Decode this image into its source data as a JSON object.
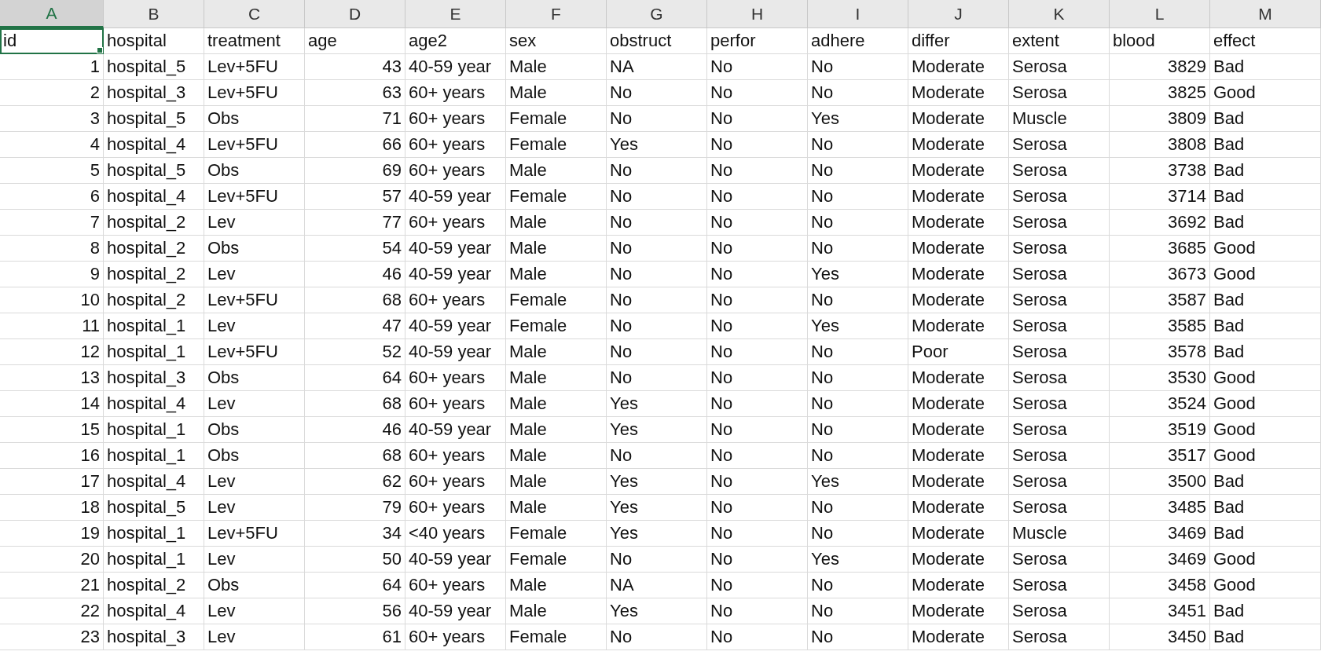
{
  "table": {
    "columns": [
      {
        "letter": "A",
        "selected": true,
        "kind": "number"
      },
      {
        "letter": "B",
        "selected": false,
        "kind": "text"
      },
      {
        "letter": "C",
        "selected": false,
        "kind": "text"
      },
      {
        "letter": "D",
        "selected": false,
        "kind": "number"
      },
      {
        "letter": "E",
        "selected": false,
        "kind": "text"
      },
      {
        "letter": "F",
        "selected": false,
        "kind": "text"
      },
      {
        "letter": "G",
        "selected": false,
        "kind": "text"
      },
      {
        "letter": "H",
        "selected": false,
        "kind": "text"
      },
      {
        "letter": "I",
        "selected": false,
        "kind": "text"
      },
      {
        "letter": "J",
        "selected": false,
        "kind": "text"
      },
      {
        "letter": "K",
        "selected": false,
        "kind": "text"
      },
      {
        "letter": "L",
        "selected": false,
        "kind": "number"
      },
      {
        "letter": "M",
        "selected": false,
        "kind": "text"
      }
    ],
    "header_row": [
      {
        "text": "id",
        "selected": true
      },
      {
        "text": "hospital",
        "selected": false
      },
      {
        "text": "treatment",
        "selected": false
      },
      {
        "text": "age",
        "selected": false
      },
      {
        "text": "age2",
        "selected": false
      },
      {
        "text": "sex",
        "selected": false
      },
      {
        "text": "obstruct",
        "selected": false
      },
      {
        "text": "perfor",
        "selected": false
      },
      {
        "text": "adhere",
        "selected": false
      },
      {
        "text": "differ",
        "selected": false
      },
      {
        "text": "extent",
        "selected": false
      },
      {
        "text": "blood",
        "selected": false
      },
      {
        "text": "effect",
        "selected": false
      }
    ],
    "rows": [
      [
        "1",
        "hospital_5",
        "Lev+5FU",
        "43",
        "40-59 year",
        "Male",
        "NA",
        "No",
        "No",
        "Moderate",
        "Serosa",
        "3829",
        "Bad"
      ],
      [
        "2",
        "hospital_3",
        "Lev+5FU",
        "63",
        "60+ years",
        "Male",
        "No",
        "No",
        "No",
        "Moderate",
        "Serosa",
        "3825",
        "Good"
      ],
      [
        "3",
        "hospital_5",
        "Obs",
        "71",
        "60+ years",
        "Female",
        "No",
        "No",
        "Yes",
        "Moderate",
        "Muscle",
        "3809",
        "Bad"
      ],
      [
        "4",
        "hospital_4",
        "Lev+5FU",
        "66",
        "60+ years",
        "Female",
        "Yes",
        "No",
        "No",
        "Moderate",
        "Serosa",
        "3808",
        "Bad"
      ],
      [
        "5",
        "hospital_5",
        "Obs",
        "69",
        "60+ years",
        "Male",
        "No",
        "No",
        "No",
        "Moderate",
        "Serosa",
        "3738",
        "Bad"
      ],
      [
        "6",
        "hospital_4",
        "Lev+5FU",
        "57",
        "40-59 year",
        "Female",
        "No",
        "No",
        "No",
        "Moderate",
        "Serosa",
        "3714",
        "Bad"
      ],
      [
        "7",
        "hospital_2",
        "Lev",
        "77",
        "60+ years",
        "Male",
        "No",
        "No",
        "No",
        "Moderate",
        "Serosa",
        "3692",
        "Bad"
      ],
      [
        "8",
        "hospital_2",
        "Obs",
        "54",
        "40-59 year",
        "Male",
        "No",
        "No",
        "No",
        "Moderate",
        "Serosa",
        "3685",
        "Good"
      ],
      [
        "9",
        "hospital_2",
        "Lev",
        "46",
        "40-59 year",
        "Male",
        "No",
        "No",
        "Yes",
        "Moderate",
        "Serosa",
        "3673",
        "Good"
      ],
      [
        "10",
        "hospital_2",
        "Lev+5FU",
        "68",
        "60+ years",
        "Female",
        "No",
        "No",
        "No",
        "Moderate",
        "Serosa",
        "3587",
        "Bad"
      ],
      [
        "11",
        "hospital_1",
        "Lev",
        "47",
        "40-59 year",
        "Female",
        "No",
        "No",
        "Yes",
        "Moderate",
        "Serosa",
        "3585",
        "Bad"
      ],
      [
        "12",
        "hospital_1",
        "Lev+5FU",
        "52",
        "40-59 year",
        "Male",
        "No",
        "No",
        "No",
        "Poor",
        "Serosa",
        "3578",
        "Bad"
      ],
      [
        "13",
        "hospital_3",
        "Obs",
        "64",
        "60+ years",
        "Male",
        "No",
        "No",
        "No",
        "Moderate",
        "Serosa",
        "3530",
        "Good"
      ],
      [
        "14",
        "hospital_4",
        "Lev",
        "68",
        "60+ years",
        "Male",
        "Yes",
        "No",
        "No",
        "Moderate",
        "Serosa",
        "3524",
        "Good"
      ],
      [
        "15",
        "hospital_1",
        "Obs",
        "46",
        "40-59 year",
        "Male",
        "Yes",
        "No",
        "No",
        "Moderate",
        "Serosa",
        "3519",
        "Good"
      ],
      [
        "16",
        "hospital_1",
        "Obs",
        "68",
        "60+ years",
        "Male",
        "No",
        "No",
        "No",
        "Moderate",
        "Serosa",
        "3517",
        "Good"
      ],
      [
        "17",
        "hospital_4",
        "Lev",
        "62",
        "60+ years",
        "Male",
        "Yes",
        "No",
        "Yes",
        "Moderate",
        "Serosa",
        "3500",
        "Bad"
      ],
      [
        "18",
        "hospital_5",
        "Lev",
        "79",
        "60+ years",
        "Male",
        "Yes",
        "No",
        "No",
        "Moderate",
        "Serosa",
        "3485",
        "Bad"
      ],
      [
        "19",
        "hospital_1",
        "Lev+5FU",
        "34",
        "<40 years",
        "Female",
        "Yes",
        "No",
        "No",
        "Moderate",
        "Muscle",
        "3469",
        "Bad"
      ],
      [
        "20",
        "hospital_1",
        "Lev",
        "50",
        "40-59 year",
        "Female",
        "No",
        "No",
        "Yes",
        "Moderate",
        "Serosa",
        "3469",
        "Good"
      ],
      [
        "21",
        "hospital_2",
        "Obs",
        "64",
        "60+ years",
        "Male",
        "NA",
        "No",
        "No",
        "Moderate",
        "Serosa",
        "3458",
        "Good"
      ],
      [
        "22",
        "hospital_4",
        "Lev",
        "56",
        "40-59 year",
        "Male",
        "Yes",
        "No",
        "No",
        "Moderate",
        "Serosa",
        "3451",
        "Bad"
      ],
      [
        "23",
        "hospital_3",
        "Lev",
        "61",
        "60+ years",
        "Female",
        "No",
        "No",
        "No",
        "Moderate",
        "Serosa",
        "3450",
        "Bad"
      ]
    ]
  }
}
